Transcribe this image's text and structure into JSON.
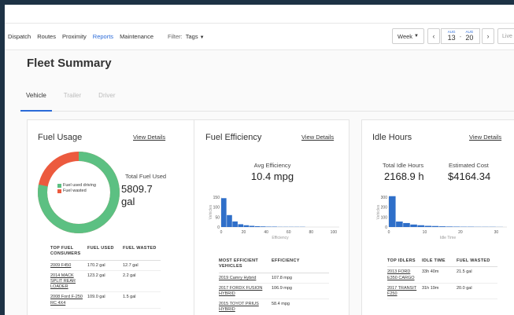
{
  "nav": {
    "items": [
      "Dispatch",
      "Routes",
      "Proximity",
      "Reports",
      "Maintenance"
    ],
    "active": "Reports",
    "filter_label": "Filter:",
    "filter_value": "Tags"
  },
  "date_controls": {
    "range_mode": "Week",
    "start_month": "AUG",
    "start_day": "13",
    "end_month": "AUG",
    "end_day": "20",
    "live_label": "Live"
  },
  "page_title": "Fleet Summary",
  "tabs": [
    "Vehicle",
    "Trailer",
    "Driver"
  ],
  "active_tab": "Vehicle",
  "colors": {
    "accent": "#2a6ad8",
    "fuel_driving": "#5cc082",
    "fuel_wasted": "#ec5a3e",
    "bar": "#2f6fc9"
  },
  "fuel_usage": {
    "title": "Fuel Usage",
    "link": "View Details",
    "total_label": "Total Fuel Used",
    "total_value": "5809.7",
    "total_unit": "gal",
    "legend": [
      {
        "label": "Fuel used driving",
        "color": "#5cc082"
      },
      {
        "label": "Fuel wasted",
        "color": "#ec5a3e"
      }
    ],
    "donut": {
      "driving_fraction": 0.78,
      "wasted_fraction": 0.22
    },
    "table": {
      "headers": [
        "TOP FUEL CONSUMERS",
        "FUEL USED",
        "FUEL WASTED"
      ],
      "rows": [
        [
          "2009 F450",
          "170.2 gal",
          "12.7 gal"
        ],
        [
          "2014 MACK SPLIT REAR LOADER",
          "123.2 gal",
          "2.2 gal"
        ],
        [
          "2008 Ford F-250 RC 4X4",
          "109.0 gal",
          "1.5 gal"
        ]
      ]
    }
  },
  "fuel_efficiency": {
    "title": "Fuel Efficiency",
    "link": "View Details",
    "avg_label": "Avg Efficiency",
    "avg_value": "10.4 mpg",
    "chart": {
      "y_label": "Vehicles",
      "x_label": "Efficiency",
      "y_ticks": [
        "150",
        "100",
        "50",
        "0"
      ],
      "x_ticks": [
        "0",
        "20",
        "40",
        "60",
        "80",
        "100"
      ],
      "values": [
        145,
        60,
        28,
        14,
        9,
        6,
        4,
        3,
        2,
        2,
        1,
        1,
        1,
        1,
        1
      ],
      "ymax": 150,
      "xmax": 105,
      "bin_width": 5
    },
    "table": {
      "headers": [
        "MOST EFFICIENT VEHICLES",
        "EFFICIENCY"
      ],
      "rows": [
        [
          "2019 Camry Hybrid",
          "107.8 mpg"
        ],
        [
          "2017 FORDX FUSION HYBRID",
          "106.9 mpg"
        ],
        [
          "2015 TOYOT PRIUS HYBRID",
          "58.4 mpg"
        ]
      ]
    }
  },
  "idle_hours": {
    "title": "Idle Hours",
    "link": "View Details",
    "total_label": "Total Idle Hours",
    "total_value": "2168.9 h",
    "cost_label": "Estimated Cost",
    "cost_value": "$4164.34",
    "chart": {
      "y_label": "Vehicles",
      "x_label": "Idle Time",
      "y_ticks": [
        "300",
        "200",
        "100",
        "0"
      ],
      "x_ticks": [
        "0",
        "10",
        "20",
        "30"
      ],
      "values": [
        310,
        55,
        40,
        25,
        18,
        12,
        10,
        7,
        5,
        4,
        3,
        3,
        2,
        2,
        2,
        1
      ],
      "ymax": 300,
      "xmax": 33,
      "bin_width": 2
    },
    "table": {
      "headers": [
        "TOP IDLERS",
        "IDLE TIME",
        "FUEL WASTED"
      ],
      "rows": [
        [
          "2013 FORD E350 CARGO",
          "33h 40m",
          "21.5 gal"
        ],
        [
          "2017 TRANSIT F250",
          "31h 19m",
          "20.0 gal"
        ]
      ]
    }
  }
}
